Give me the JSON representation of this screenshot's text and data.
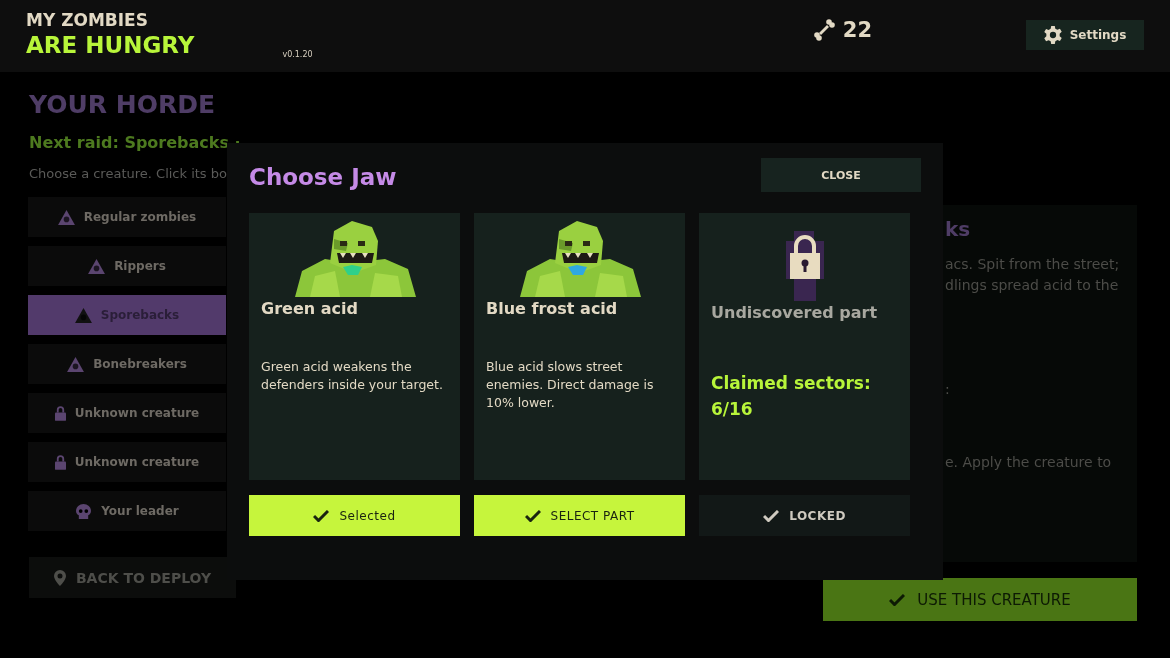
{
  "header": {
    "title_top": "MY ZOMBIES",
    "title_bottom": "ARE HUNGRY",
    "version": "v0.1.20",
    "bones": "22",
    "settings": "Settings"
  },
  "page": {
    "heading": "YOUR HORDE",
    "next_raid": "Next raid: Sporebacks ·",
    "hint": "Choose a creature. Click its bo"
  },
  "sidebar": {
    "items": [
      {
        "label": "Regular zombies",
        "kind": "creature",
        "selected": false
      },
      {
        "label": "Rippers",
        "kind": "creature",
        "selected": false
      },
      {
        "label": "Sporebacks",
        "kind": "creature",
        "selected": true
      },
      {
        "label": "Bonebreakers",
        "kind": "creature",
        "selected": false
      },
      {
        "label": "Unknown creature",
        "kind": "locked",
        "selected": false
      },
      {
        "label": "Unknown creature",
        "kind": "locked",
        "selected": false
      },
      {
        "label": "Your leader",
        "kind": "leader",
        "selected": false
      }
    ]
  },
  "back_button": "BACK TO DEPLOY",
  "detail": {
    "title": "ks",
    "lines": [
      "acs. Spit from the street;",
      "dlings spread acid to the"
    ],
    "line_3": ":",
    "line_4": "e. Apply the creature to"
  },
  "use_button": "USE THIS CREATURE",
  "modal": {
    "title": "Choose Jaw",
    "close": "CLOSE",
    "parts": [
      {
        "kind": "part",
        "name": "Green acid",
        "description": "Green acid weakens the defenders inside your target.",
        "color": "#2fd08a",
        "button": "Selected",
        "disabled": false
      },
      {
        "kind": "part",
        "name": "Blue frost acid",
        "description": "Blue acid slows street enemies. Direct damage is 10% lower.",
        "color": "#2fa8e0",
        "button": "SELECT PART",
        "disabled": false
      },
      {
        "kind": "locked",
        "name": "Undiscovered part",
        "claimed": "Claimed sectors: 6/16",
        "button": "LOCKED",
        "disabled": true
      }
    ]
  }
}
